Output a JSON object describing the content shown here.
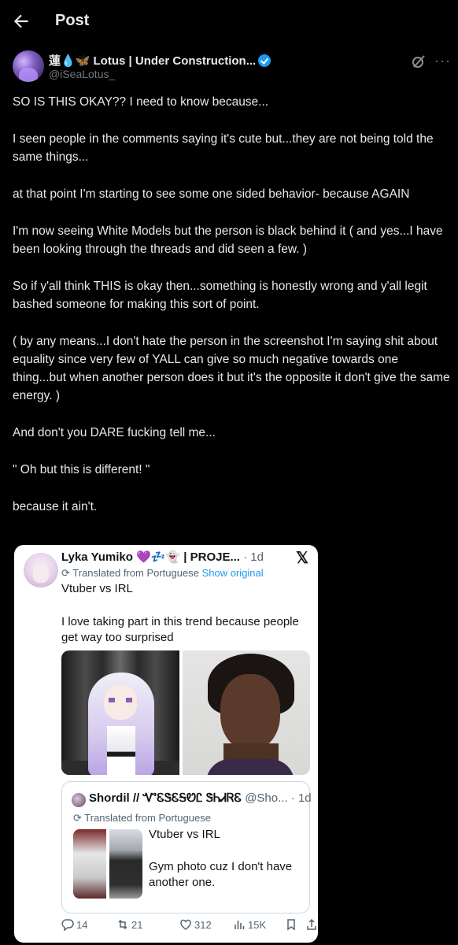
{
  "header": {
    "title": "Post"
  },
  "author": {
    "display_name": "蓮💧🦋 Lotus | Under Construction...",
    "handle": "@iSeaLotus_"
  },
  "post": {
    "paragraphs": [
      "SO IS THIS OKAY?? I need to know because...",
      "I seen people in the comments saying it's cute but...they are not being told the same things...",
      "at that point I'm starting to see some one sided behavior- because AGAIN",
      "I'm now seeing White Models but the person is black behind it ( and yes...I have been looking through the threads and did seen a few. )",
      "So if y'all think THIS is okay then...something is honestly wrong and y'all legit bashed someone for making this sort of point.",
      "( by any means...I don't hate the person in the screenshot I'm saying shit about equality since very few of YALL can give so much negative towards one thing...but when another person does it but it's the opposite it don't give the same energy. )",
      "And don't you DARE fucking tell me...",
      "\" Oh but this is different! \"",
      "because it ain't."
    ]
  },
  "embed": {
    "name": "Lyka Yumiko 💜💤👻 | PROJE...",
    "time": "· 1d",
    "x_logo": "𝕏",
    "translated": "Translated from Portuguese",
    "show_original": "Show original",
    "line1": "Vtuber vs IRL",
    "line2": "I love taking part in this trend because people get way too surprised",
    "quote": {
      "name": "Shordil // ᏉᏋᏕᏋᎦᏬᏝ ᏕᏂᏗᏒᏋ",
      "handle": "@Sho... · 1d",
      "translated": "Translated from Portuguese",
      "line1": "Vtuber vs IRL",
      "line2": "Gym photo cuz I don't have another one."
    },
    "actions": {
      "replies": "14",
      "reposts": "21",
      "likes": "312",
      "views": "15K"
    }
  }
}
